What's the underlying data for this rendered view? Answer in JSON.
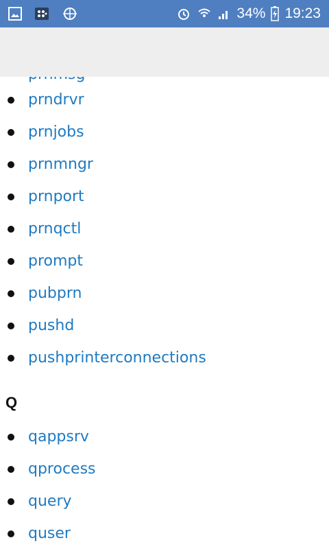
{
  "status_bar": {
    "icons_left": [
      "image-icon",
      "bbm-icon",
      "globe-icon"
    ],
    "icons_right": [
      "alarm-icon",
      "wifi-icon",
      "signal-icon"
    ],
    "battery": "34%",
    "time": "19:23"
  },
  "content": {
    "cut_item": "prnmsg",
    "list_p": [
      "prndrvr",
      "prnjobs",
      "prnmngr",
      "prnport",
      "prnqctl",
      "prompt",
      "pubprn",
      "pushd",
      "pushprinterconnections"
    ],
    "section_q": "Q",
    "list_q": [
      "qappsrv",
      "qprocess",
      "query",
      "quser"
    ],
    "link_color": "#1e7ac2"
  }
}
